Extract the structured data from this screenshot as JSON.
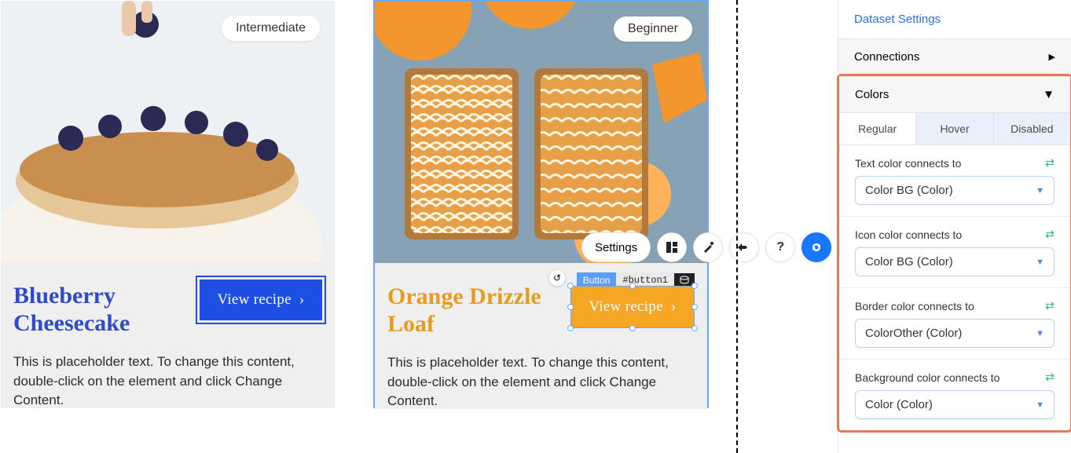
{
  "cards": [
    {
      "badge": "Intermediate",
      "title": "Blueberry Cheesecake",
      "title_color": "#2f4acb",
      "button_label": "View recipe",
      "description": "This is placeholder text. To change this content, double-click on the element and click Change Content."
    },
    {
      "badge": "Beginner",
      "title": "Orange Drizzle Loaf",
      "title_color": "#e79c1f",
      "button_label": "View recipe",
      "description": "This is placeholder text. To change this content, double-click on the element and click Change Content."
    }
  ],
  "element_tag": {
    "type": "Button",
    "id": "#button1"
  },
  "float_toolbar": {
    "settings": "Settings"
  },
  "panel": {
    "dataset_link": "Dataset Settings",
    "sections": {
      "connections": "Connections",
      "colors": "Colors"
    },
    "tabs": [
      "Regular",
      "Hover",
      "Disabled"
    ],
    "active_tab": 0,
    "fields": [
      {
        "label": "Text color connects to",
        "value": "Color BG (Color)"
      },
      {
        "label": "Icon color connects to",
        "value": "Color BG (Color)"
      },
      {
        "label": "Border color connects to",
        "value": "ColorOther (Color)"
      },
      {
        "label": "Background color connects to",
        "value": "Color (Color)"
      }
    ]
  }
}
